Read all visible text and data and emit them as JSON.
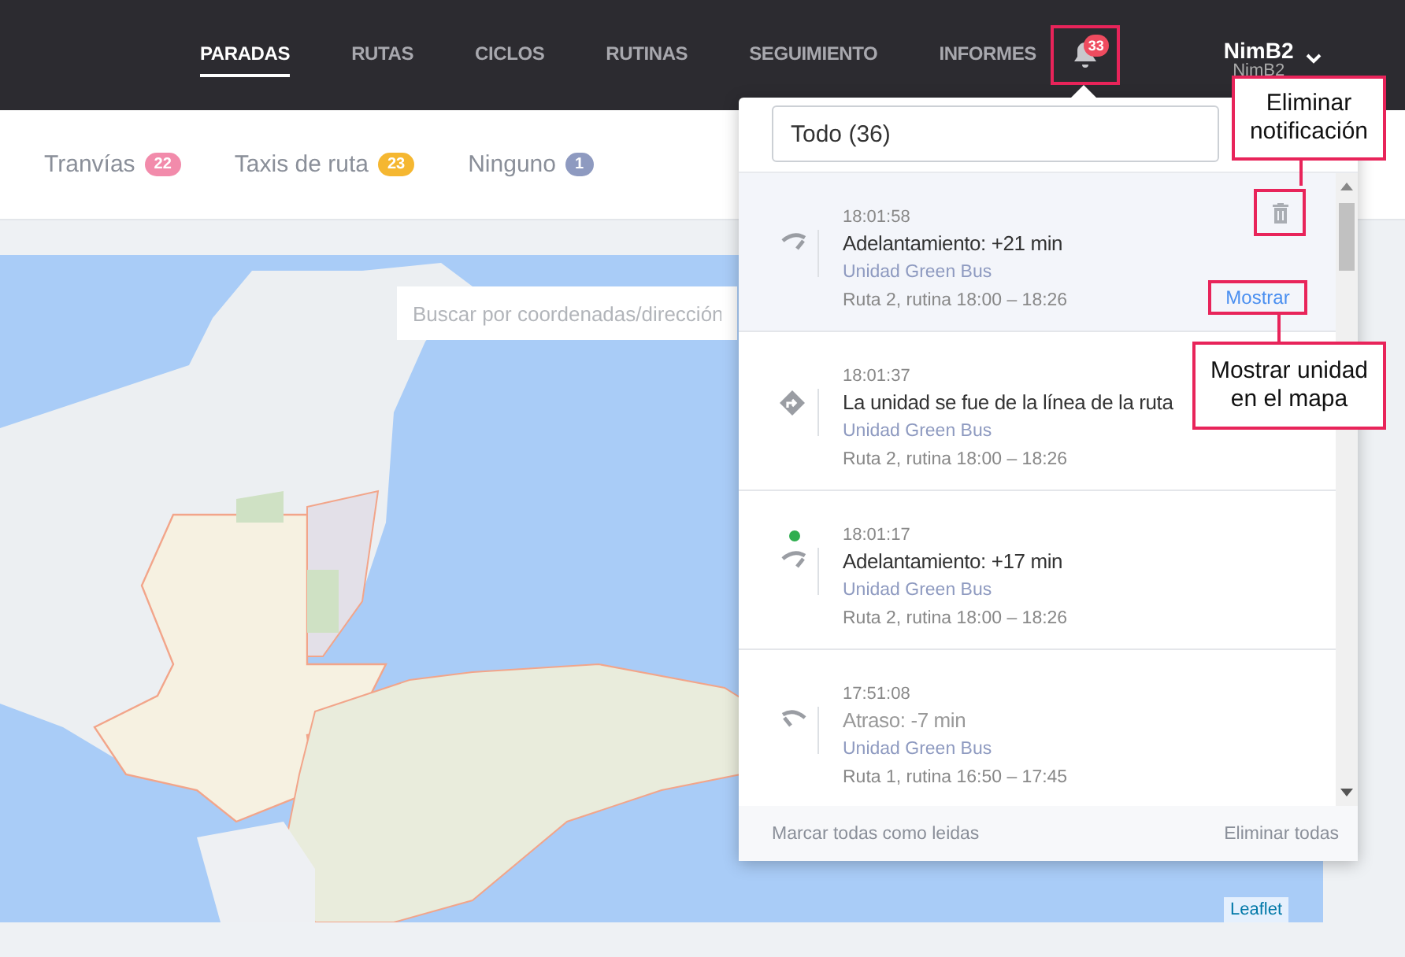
{
  "nav": {
    "items": [
      {
        "label": "PARADAS",
        "selected": true
      },
      {
        "label": "RUTAS",
        "selected": false
      },
      {
        "label": "CICLOS",
        "selected": false
      },
      {
        "label": "RUTINAS",
        "selected": false
      },
      {
        "label": "SEGUIMIENTO",
        "selected": false
      },
      {
        "label": "INFORMES",
        "selected": false
      }
    ],
    "notification_count": "33",
    "user": {
      "name": "NimB2",
      "subtitle": "NimB2"
    }
  },
  "filters": [
    {
      "label": "Tranvías",
      "count": "22",
      "color": "#f28bab"
    },
    {
      "label": "Taxis de ruta",
      "count": "23",
      "color": "#f5b731"
    },
    {
      "label": "Ninguno",
      "count": "1",
      "color": "#8e9ac0"
    }
  ],
  "map": {
    "search": {
      "placeholder": "Buscar por coordenadas/dirección"
    },
    "attribution": "Leaflet"
  },
  "notification_panel": {
    "filter": "Todo (36)",
    "show_label": "Mostrar",
    "items": [
      {
        "kind": "early",
        "time": "18:01:58",
        "title": "Adelantamiento: +21 min",
        "unit": "Unidad Green Bus",
        "route": "Ruta 2, rutina 18:00 – 18:26",
        "unread": false,
        "hovered": true,
        "faded": false
      },
      {
        "kind": "off_route",
        "time": "18:01:37",
        "title": "La unidad se fue de la línea de la ruta",
        "unit": "Unidad Green Bus",
        "route": "Ruta 2, rutina 18:00 – 18:26",
        "unread": false,
        "hovered": false,
        "faded": false
      },
      {
        "kind": "early",
        "time": "18:01:17",
        "title": "Adelantamiento: +17 min",
        "unit": "Unidad Green Bus",
        "route": "Ruta 2, rutina 18:00 – 18:26",
        "unread": true,
        "hovered": false,
        "faded": false
      },
      {
        "kind": "late",
        "time": "17:51:08",
        "title": "Atraso: -7 min",
        "unit": "Unidad Green Bus",
        "route": "Ruta 1, rutina 16:50 – 17:45",
        "unread": false,
        "hovered": false,
        "faded": true
      }
    ],
    "footer": {
      "mark_all": "Marcar todas como leidas",
      "delete_all": "Eliminar todas"
    }
  },
  "callouts": [
    {
      "text": "Eliminar notificación"
    },
    {
      "text": "Mostrar unidad en el mapa"
    }
  ]
}
